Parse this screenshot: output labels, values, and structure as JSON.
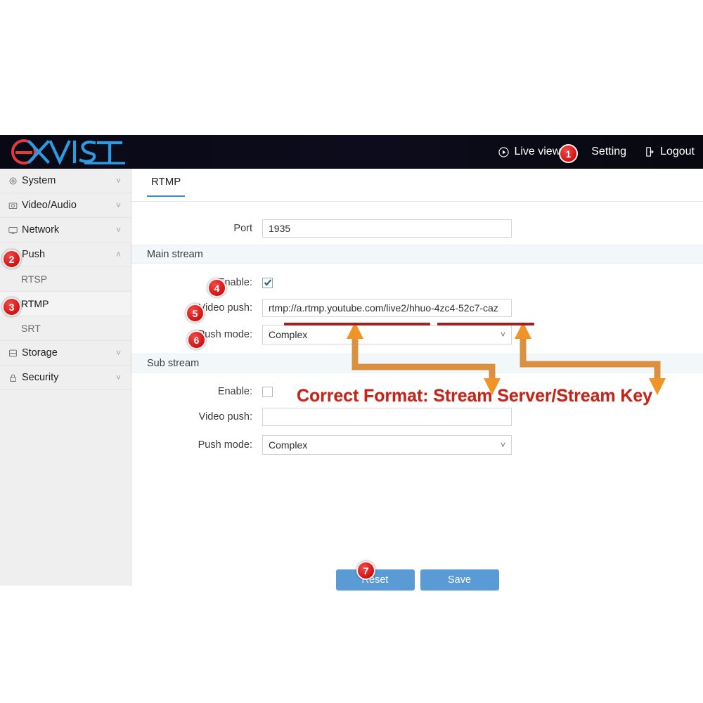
{
  "header": {
    "logo_text": "eXVIST",
    "nav": [
      {
        "label": "Live view",
        "icon": "play-circle-icon"
      },
      {
        "label": "Setting",
        "icon": "none",
        "badge": "1"
      },
      {
        "label": "Logout",
        "icon": "logout-icon"
      }
    ]
  },
  "sidebar": {
    "items": [
      {
        "label": "System",
        "icon": "gear-icon",
        "chevron": "chevron-down-icon",
        "type": "parent"
      },
      {
        "label": "Video/Audio",
        "icon": "camera-icon",
        "chevron": "chevron-down-icon",
        "type": "parent"
      },
      {
        "label": "Network",
        "icon": "monitor-icon",
        "chevron": "chevron-down-icon",
        "type": "parent"
      },
      {
        "label": "Push",
        "icon": "upload-icon",
        "chevron": "chevron-up-icon",
        "type": "parent",
        "badge": "2",
        "expanded": true
      },
      {
        "label": "RTSP",
        "type": "child"
      },
      {
        "label": "RTMP",
        "type": "child",
        "badge": "3",
        "active": true
      },
      {
        "label": "SRT",
        "type": "child"
      },
      {
        "label": "Storage",
        "icon": "storage-icon",
        "chevron": "chevron-down-icon",
        "type": "parent"
      },
      {
        "label": "Security",
        "icon": "lock-icon",
        "chevron": "chevron-down-icon",
        "type": "parent"
      }
    ]
  },
  "main": {
    "tab": "RTMP",
    "port": {
      "label": "Port",
      "value": "1935"
    },
    "main_stream": {
      "band": "Main stream",
      "enable": {
        "label": "Enable:",
        "checked": true,
        "badge": "4"
      },
      "video_push": {
        "label": "Video push:",
        "value": "rtmp://a.rtmp.youtube.com/live2/hhuo-4zc4-52c7-caz",
        "badge": "5"
      },
      "push_mode": {
        "label": "Push mode:",
        "value": "Complex",
        "badge": "6"
      }
    },
    "sub_stream": {
      "band": "Sub stream",
      "enable": {
        "label": "Enable:",
        "checked": false
      },
      "video_push": {
        "label": "Video push:",
        "value": "",
        "placeholder": ""
      },
      "push_mode": {
        "label": "Push mode:",
        "value": "Complex"
      }
    },
    "buttons": {
      "reset": "Reset",
      "save": "Save",
      "save_badge": "7"
    }
  },
  "annotation": {
    "text": "Correct Format: Stream Server/Stream Key",
    "text_color": "#c0271c",
    "arrow_color": "#ef8f2b",
    "underline_color": "#a32020"
  },
  "colors": {
    "header_bg": "#0a0a18",
    "accent_blue": "#5b9bd5",
    "tab_underline": "#3e8ccc",
    "badge_red": "#d41414",
    "band_bg": "#f2f8fa",
    "sidebar_bg": "#efefef"
  }
}
